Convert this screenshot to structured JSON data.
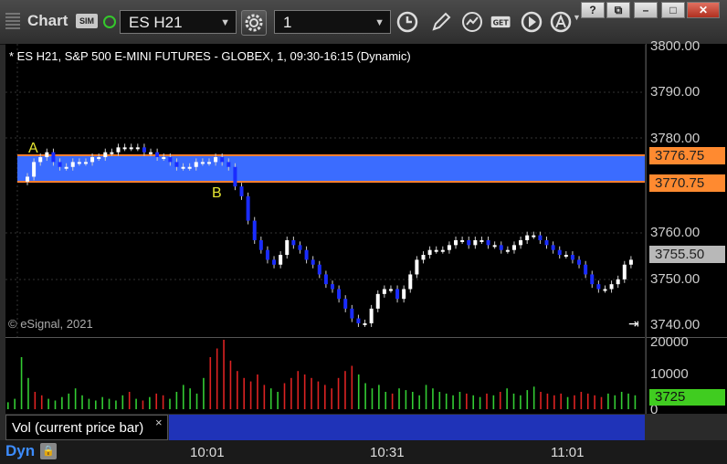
{
  "toolbar": {
    "title": "Chart",
    "sim_badge": "SIM",
    "symbol": "ES H21",
    "interval": "1"
  },
  "chart": {
    "title": "* ES H21, S&P 500 E-MINI FUTURES - GLOBEX, 1, 09:30-16:15 (Dynamic)",
    "copyright": "© eSignal, 2021",
    "zone": {
      "top_label": "A",
      "bottom_label": "B",
      "color": "#3b6cff",
      "border": "#ff7f30"
    }
  },
  "price_axis": {
    "ticks": [
      "3800.00",
      "3790.00",
      "3780.00",
      "3760.00",
      "3750.00",
      "3740.00"
    ],
    "badges": [
      {
        "label": "3776.75",
        "color": "#ff8a30"
      },
      {
        "label": "3770.75",
        "color": "#ff8a30"
      },
      {
        "label": "3755.50",
        "color": "#b8b8b8"
      }
    ]
  },
  "volume": {
    "ticks": [
      "20000",
      "10000",
      "0"
    ],
    "current": "3725",
    "study_label": "Vol (current price bar)"
  },
  "time_axis": {
    "labels": [
      "10:01",
      "10:31",
      "11:01"
    ],
    "mode": "Dyn"
  },
  "chart_data": {
    "type": "candlestick",
    "ylim": [
      3740,
      3800
    ],
    "close_series": [
      3773,
      3776,
      3777,
      3778,
      3776,
      3775,
      3775,
      3776,
      3776,
      3776,
      3777,
      3777,
      3778,
      3778,
      3779,
      3779,
      3779,
      3779,
      3778,
      3778,
      3777,
      3777,
      3776,
      3775,
      3775,
      3775,
      3776,
      3776,
      3776,
      3777,
      3776,
      3775,
      3771,
      3769,
      3764,
      3760,
      3758,
      3756,
      3755,
      3757,
      3760,
      3759,
      3758,
      3756,
      3755,
      3753,
      3751,
      3750,
      3748,
      3746,
      3744,
      3743,
      3743,
      3746,
      3749,
      3750,
      3750,
      3748,
      3750,
      3753,
      3756,
      3757,
      3758,
      3758,
      3758,
      3759,
      3760,
      3760,
      3759,
      3760,
      3760,
      3759,
      3759,
      3758,
      3758,
      3759,
      3760,
      3761,
      3761,
      3760,
      3759,
      3758,
      3757,
      3757,
      3756,
      3755,
      3753,
      3751,
      3750,
      3750,
      3751,
      3752,
      3755,
      3756
    ]
  }
}
